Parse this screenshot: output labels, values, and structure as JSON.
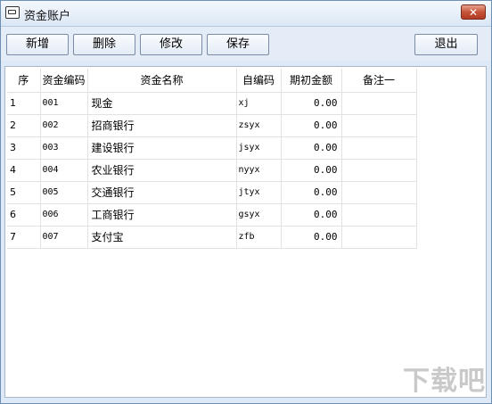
{
  "window": {
    "title": "资金账户",
    "close_label": "✕"
  },
  "toolbar": {
    "add_label": "新增",
    "delete_label": "删除",
    "edit_label": "修改",
    "save_label": "保存",
    "exit_label": "退出"
  },
  "table": {
    "headers": [
      "序",
      "资金编码",
      "资金名称",
      "自编码",
      "期初金额",
      "备注一"
    ],
    "rows": [
      [
        "1",
        "001",
        "现金",
        "xj",
        "0.00",
        ""
      ],
      [
        "2",
        "002",
        "招商银行",
        "zsyx",
        "0.00",
        ""
      ],
      [
        "3",
        "003",
        "建设银行",
        "jsyx",
        "0.00",
        ""
      ],
      [
        "4",
        "004",
        "农业银行",
        "nyyx",
        "0.00",
        ""
      ],
      [
        "5",
        "005",
        "交通银行",
        "jtyx",
        "0.00",
        ""
      ],
      [
        "6",
        "006",
        "工商银行",
        "gsyx",
        "0.00",
        ""
      ],
      [
        "7",
        "007",
        "支付宝",
        "zfb",
        "0.00",
        ""
      ]
    ]
  },
  "watermark": "下载吧"
}
